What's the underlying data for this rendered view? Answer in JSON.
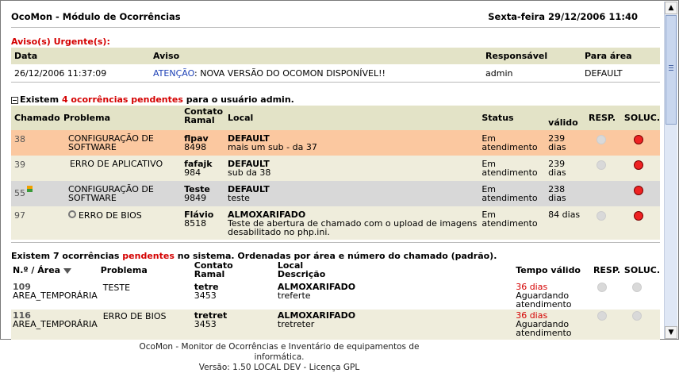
{
  "header": {
    "app_title": "OcoMon - Módulo de Ocorrências",
    "date": "Sexta-feira 29/12/2006 11:40"
  },
  "urgent": {
    "title": "Aviso(s) Urgente(s):",
    "columns": [
      "Data",
      "Aviso",
      "Responsável",
      "Para área"
    ],
    "row": {
      "date": "26/12/2006 11:37:09",
      "aviso_prefix": "ATENÇÃO",
      "aviso_text": ": NOVA VERSÃO DO OCOMON DISPONÍVEL!!",
      "responsavel": "admin",
      "para_area": "DEFAULT"
    }
  },
  "user_section": {
    "intro_a": "Existem ",
    "intro_count": "4 ocorrências pendentes",
    "intro_b": " para o usuário admin.",
    "columns": {
      "chamado": "Chamado",
      "problema": "Problema",
      "contato": "Contato",
      "ramal": "Ramal",
      "local": "Local",
      "status": "Status",
      "valido": "válido",
      "resp": "RESP.",
      "soluc": "SOLUC."
    },
    "rows": [
      {
        "id": "38",
        "problema_l1": "CONFIGURAÇÃO DE",
        "problema_l2": "SOFTWARE",
        "contato": "flpav",
        "ramal": "8498",
        "local": "DEFAULT",
        "desc": "mais um sub - da 37",
        "status_l1": "Em",
        "status_l2": "atendimento",
        "valido_l1": "239",
        "valido_l2": "dias"
      },
      {
        "id": "39",
        "problema_l1": "ERRO DE APLICATIVO",
        "problema_l2": "",
        "contato": "fafajk",
        "ramal": "984",
        "local": "DEFAULT",
        "desc": "sub da 38",
        "status_l1": "Em",
        "status_l2": "atendimento",
        "valido_l1": "239",
        "valido_l2": "dias"
      },
      {
        "id": "55",
        "problema_l1": "CONFIGURAÇÃO DE",
        "problema_l2": "SOFTWARE",
        "contato": "Teste",
        "ramal": "9849",
        "local": "DEFAULT",
        "desc": "teste",
        "status_l1": "Em",
        "status_l2": "atendimento",
        "valido_l1": "238",
        "valido_l2": "dias"
      },
      {
        "id": "97",
        "problema_l1": "ERRO DE BIOS",
        "problema_l2": "",
        "contato": "Flávio",
        "ramal": "8518",
        "local": "ALMOXARIFADO",
        "desc": "Teste de abertura de chamado com o upload de imagens",
        "desc2": "desabilitado no php.ini.",
        "status_l1": "Em",
        "status_l2": "atendimento",
        "valido_l1": "84 dias",
        "valido_l2": ""
      }
    ]
  },
  "system_section": {
    "intro_a": "Existem 7 ocorrências ",
    "intro_pend": "pendentes",
    "intro_b": " no sistema. Ordenadas por área e número do chamado (padrão).",
    "columns": {
      "num_area": "N.º / Área",
      "problema": "Problema",
      "contato": "Contato",
      "ramal": "Ramal",
      "local": "Local",
      "descricao": "Descrição",
      "tempo": "Tempo válido",
      "resp": "RESP.",
      "soluc": "SOLUC."
    },
    "rows": [
      {
        "id": "109",
        "area": "AREA_TEMPORÁRIA",
        "problema": "TESTE",
        "contato": "tetre",
        "ramal": "3453",
        "local": "ALMOXARIFADO",
        "desc": "treferte",
        "tempo": "36 dias",
        "status_l1": "Aguardando",
        "status_l2": "atendimento"
      },
      {
        "id": "116",
        "area": "AREA_TEMPORÁRIA",
        "problema": "ERRO DE BIOS",
        "contato": "tretret",
        "ramal": "3453",
        "local": "ALMOXARIFADO",
        "desc": "tretreter",
        "tempo": "36 dias",
        "status_l1": "Aguardando",
        "status_l2": "atendimento"
      }
    ]
  },
  "footer": {
    "line1": "OcoMon - Monitor de Ocorrências e Inventário de equipamentos de informática.",
    "line2": "Versão: 1.50 LOCAL DEV - Licença GPL"
  }
}
